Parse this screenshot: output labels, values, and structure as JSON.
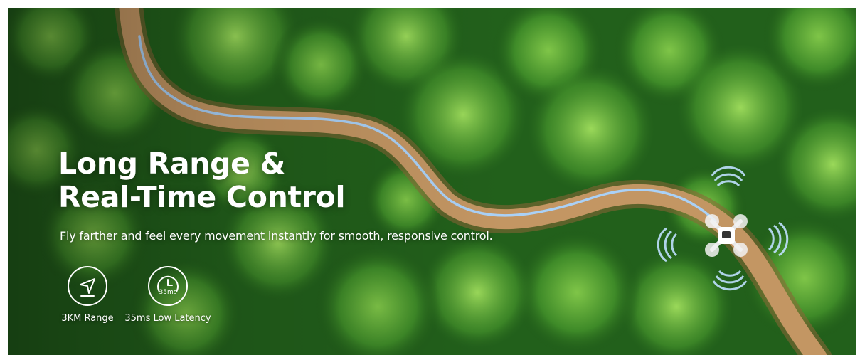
{
  "hero": {
    "title_line1": "Long Range &",
    "title_line2": "Real-Time Control",
    "subtitle": "Fly farther and feel every movement instantly for smooth, responsive control."
  },
  "features": [
    {
      "icon": "navigation-arrow-icon",
      "label": "3KM Range"
    },
    {
      "icon": "latency-clock-icon",
      "icon_text": "35ms",
      "label": "35ms Low Latency"
    }
  ],
  "colors": {
    "forest_dark": "#1b4f16",
    "forest_mid": "#3f8a2a",
    "forest_light": "#7ec447",
    "road": "#b98a52",
    "flight_path": "#a9d4ff",
    "text": "#ffffff"
  }
}
